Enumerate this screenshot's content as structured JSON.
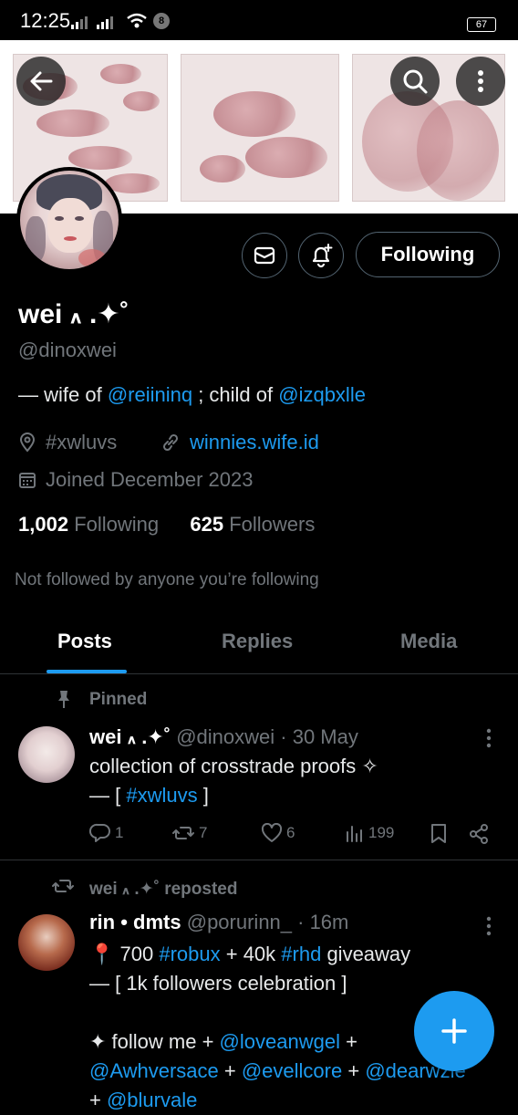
{
  "status_bar": {
    "time": "12:25",
    "notification_count": "8",
    "battery": "67"
  },
  "profile": {
    "display_name": "wei ៱ .✦˚",
    "handle": "@dinoxwei",
    "bio_prefix": "— wife of ",
    "bio_mention_1": "@reiininq",
    "bio_middle": " ; child of ",
    "bio_mention_2": "@izqbxlle",
    "location": "#xwluvs",
    "website": "winnies.wife.id",
    "joined": "Joined December 2023",
    "following_count": "1,002",
    "following_label": "Following",
    "followers_count": "625",
    "followers_label": "Followers",
    "not_followed": "Not followed by anyone you’re following"
  },
  "actions": {
    "following_button": "Following"
  },
  "tabs": [
    {
      "label": "Posts"
    },
    {
      "label": "Replies"
    },
    {
      "label": "Media"
    }
  ],
  "pinned_post": {
    "pinned_label": "Pinned",
    "author_name": "wei ៱ .✦˚",
    "author_meta": "@dinoxwei · 30 May",
    "text_line_1": "collection of crosstrade proofs ✧",
    "text_line_2_prefix": "— [ ",
    "hashtag": "#xwluvs",
    "text_line_2_suffix": " ]",
    "replies": "1",
    "reposts": "7",
    "likes": "6",
    "views": "199"
  },
  "repost": {
    "repost_label": "wei ៱ .✦˚ reposted",
    "author_name": "rin • dmts",
    "author_meta": "@porurinn_ · 16m",
    "line_1_pin": "📍",
    "line_1_a": " 700 ",
    "line_1_tag_1": "#robux",
    "line_1_b": " + 40k ",
    "line_1_tag_2": "#rhd",
    "line_1_c": " giveaway",
    "line_2": "— [ 1k followers celebration ]",
    "line_3_a": "✦ follow me + ",
    "line_3_mention": "@loveanwgel",
    "line_3_b": " +",
    "line_4_m1": "@Awhversace",
    "line_4_a": " + ",
    "line_4_m2": "@evellcore",
    "line_4_b": " + ",
    "line_4_m3": "@dearwzle",
    "line_5_a": "+ ",
    "line_5_m": "@blurvale"
  },
  "colors": {
    "accent": "#1d9bf0",
    "background": "#000000",
    "muted": "#71767b",
    "divider": "#2f3336"
  }
}
